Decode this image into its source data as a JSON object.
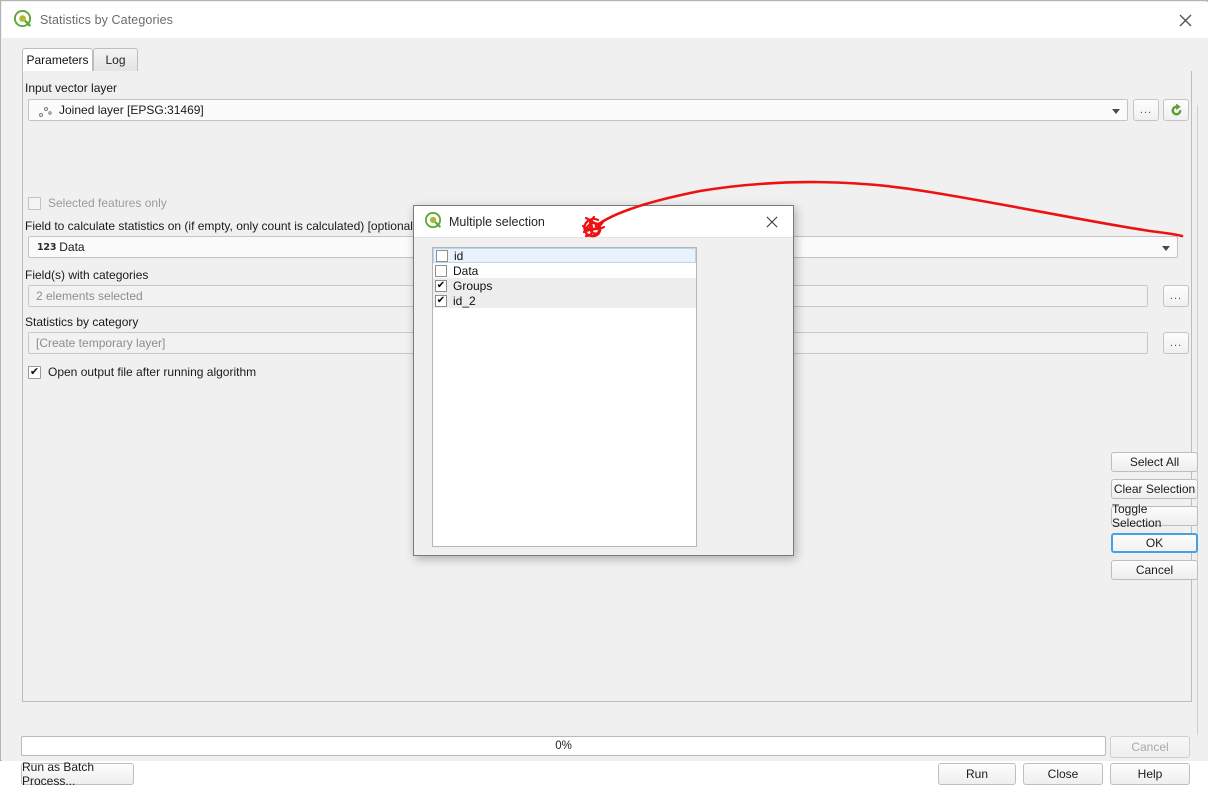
{
  "window": {
    "title": "Statistics by Categories",
    "close_icon": "close-icon",
    "logo_icon": "qgis-logo-icon"
  },
  "tabs": [
    {
      "label": "Parameters",
      "active": true
    },
    {
      "label": "Log",
      "active": false
    }
  ],
  "parameters": {
    "input_layer_label": "Input vector layer",
    "input_layer_value": "Joined layer [EPSG:31469]",
    "input_layer_icon": "point-layer-icon",
    "browse_button_label": "...",
    "refresh_button_icon": "refresh-icon",
    "selected_features_label": "Selected features only",
    "selected_features_checked": false,
    "stat_field_label": "Field to calculate statistics on (if empty, only count is calculated) [optional]",
    "stat_field_prefix": "123",
    "stat_field_value": "Data",
    "categories_label": "Field(s) with categories",
    "categories_value": "2 elements selected",
    "categories_browse_label": "...",
    "output_label": "Statistics by category",
    "output_value": "[Create temporary layer]",
    "output_browse_label": "...",
    "open_output_label": "Open output file after running algorithm",
    "open_output_checked": true
  },
  "footer": {
    "progress_text": "0%",
    "progress_percent": 0,
    "cancel_top_label": "Cancel",
    "batch_label": "Run as Batch Process...",
    "run_label": "Run",
    "close_label": "Close",
    "help_label": "Help"
  },
  "dialog": {
    "title": "Multiple selection",
    "logo_icon": "qgis-logo-icon",
    "close_icon": "close-icon",
    "items": [
      {
        "label": "id",
        "checked": false,
        "current": true,
        "alt": false
      },
      {
        "label": "Data",
        "checked": false,
        "current": false,
        "alt": false
      },
      {
        "label": "Groups",
        "checked": true,
        "current": false,
        "alt": true
      },
      {
        "label": "id_2",
        "checked": true,
        "current": false,
        "alt": true
      }
    ],
    "buttons": [
      {
        "label": "Select All",
        "default": false
      },
      {
        "label": "Clear Selection",
        "default": false
      },
      {
        "label": "Toggle Selection",
        "default": false
      },
      {
        "label": "OK",
        "default": true
      },
      {
        "label": "Cancel",
        "default": false
      }
    ]
  },
  "annotation": {
    "color": "#ee1111",
    "description": "red hand-drawn arc from scribble blob near dialog title to the categories browse button"
  }
}
